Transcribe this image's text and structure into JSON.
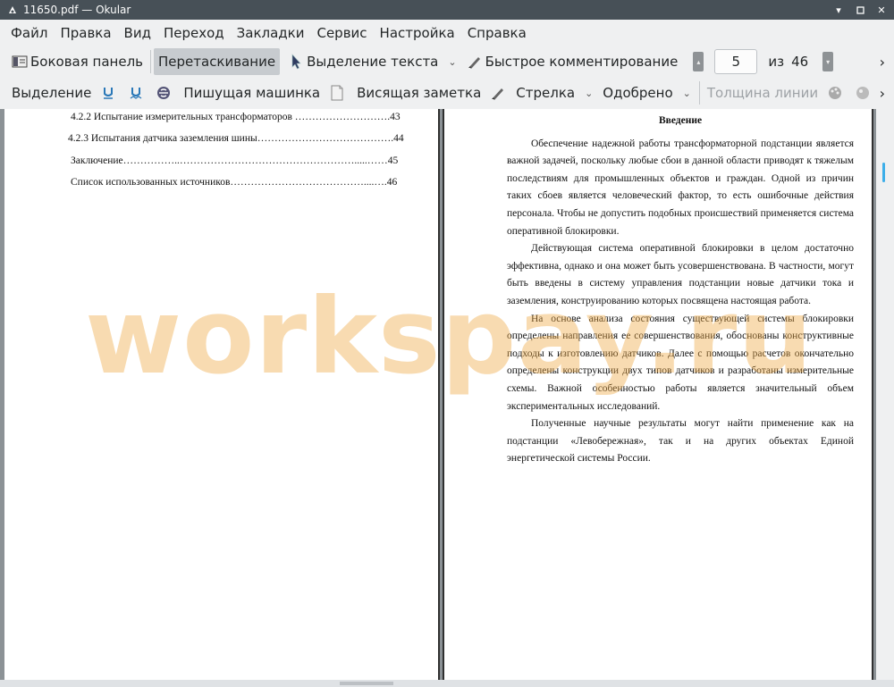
{
  "window": {
    "title": "11650.pdf — Okular",
    "controls": [
      "▾",
      "▴",
      "✕"
    ]
  },
  "menu": [
    "Файл",
    "Правка",
    "Вид",
    "Переход",
    "Закладки",
    "Сервис",
    "Настройка",
    "Справка"
  ],
  "toolbar1": {
    "sidebar_label": "Боковая панель",
    "drag_label": "Перетаскивание",
    "text_select_label": "Выделение текста",
    "quick_comment_label": "Быстрое комментирование",
    "page_current": "5",
    "page_of_label": "из",
    "page_total": "46",
    "overflow": "›"
  },
  "toolbar2": {
    "selection_label": "Выделение",
    "typewriter_label": "Пишущая машинка",
    "hanging_note_label": "Висящая заметка",
    "arrow_label": "Стрелка",
    "approved_label": "Одобрено",
    "line_width_label": "Толщина линии",
    "overflow": "›"
  },
  "left_page": {
    "toc": [
      {
        "text": "4.2.2 Испытание измерительных трансформаторов ……………………….43"
      },
      {
        "text": "4.2.3 Испытания датчика заземления шины………………………………….44"
      },
      {
        "text": "Заключение……………..…………………………………………….....……45"
      },
      {
        "text": "Список использованных источников…………………………………....….46"
      }
    ]
  },
  "right_page": {
    "heading": "Введение",
    "paragraphs": [
      "Обеспечение надежной работы трансформаторной подстанции является важной задачей, поскольку любые сбои в данной области приводят к тяжелым последствиям для промышленных объектов и граждан. Одной из причин таких сбоев является человеческий фактор, то есть ошибочные действия персонала. Чтобы не допустить подобных происшествий применяется система оперативной блокировки.",
      "Действующая система оперативной блокировки в целом достаточно эффективна, однако и она может быть усовершенствована. В частности, могут быть введены в систему управления подстанции новые датчики тока и заземления, конструированию которых посвящена настоящая работа.",
      "На основе анализа состояния существующей системы блокировки определены направления ее совершенствования, обоснованы конструктивные подходы к изготовлению датчиков. Далее с помощью расчетов окончательно определены конструкции двух типов датчиков и разработаны измерительные схемы. Важной особенностью работы является значительный объем экспериментальных исследований.",
      "Полученные научные результаты могут найти применение как на подстанции «Левобережная», так и на других объектах Единой энергетической системы России."
    ]
  },
  "watermark": "workspay.ru"
}
